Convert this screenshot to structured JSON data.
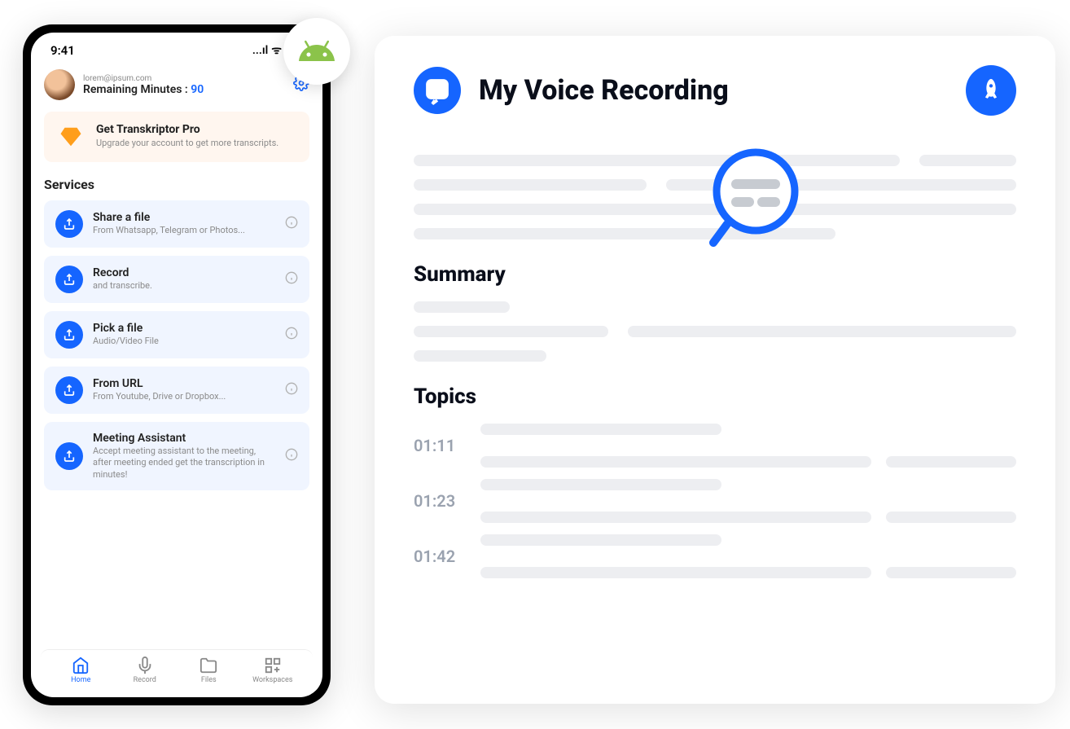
{
  "phone": {
    "status": {
      "time": "9:41",
      "signal": "...ıl",
      "wifi": "ᯤ",
      "battery": "■"
    },
    "user": {
      "email": "lorem@ipsum.com",
      "remaining_label": "Remaining Minutes :",
      "remaining_value": "90"
    },
    "pro": {
      "title": "Get Transkriptor Pro",
      "subtitle": "Upgrade your account to get more transcripts."
    },
    "services_heading": "Services",
    "services": [
      {
        "title": "Share a file",
        "subtitle": "From Whatsapp, Telegram or Photos..."
      },
      {
        "title": "Record",
        "subtitle": "and transcribe."
      },
      {
        "title": "Pick a file",
        "subtitle": "Audio/Video File"
      },
      {
        "title": "From URL",
        "subtitle": "From Youtube, Drive or Dropbox..."
      },
      {
        "title": "Meeting Assistant",
        "subtitle": "Accept meeting assistant to the meeting, after meeting ended get the transcription in minutes!"
      }
    ],
    "nav": [
      {
        "label": "Home"
      },
      {
        "label": "Record"
      },
      {
        "label": "Files"
      },
      {
        "label": "Workspaces"
      }
    ]
  },
  "card": {
    "title": "My Voice Recording",
    "summary_heading": "Summary",
    "topics_heading": "Topics",
    "topics": [
      "01:11",
      "01:23",
      "01:42"
    ]
  }
}
